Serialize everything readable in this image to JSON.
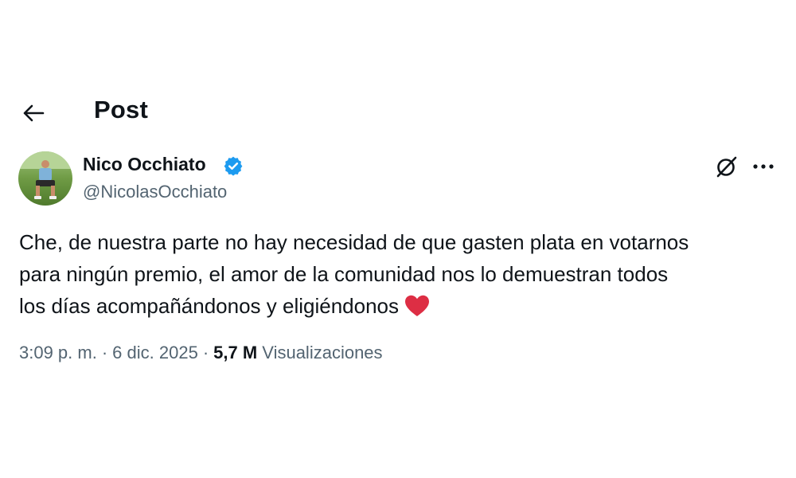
{
  "header": {
    "back_icon": "arrow-left-icon",
    "title": "Post"
  },
  "author": {
    "name": "Nico Occhiato",
    "handle": "@NicolasOcchiato",
    "verified": true,
    "verified_color": "#1d9bf0"
  },
  "actions": {
    "grok_icon": "grok-icon",
    "more_icon": "more-horizontal-icon"
  },
  "tweet": {
    "lines": [
      "Che, de nuestra parte no hay necesidad de que gasten plata en votarnos",
      "para ningún premio, el amor de la comunidad nos lo demuestran todos",
      "los días acompañándonos y eligiéndonos"
    ],
    "emoji": "heart-icon",
    "emoji_color": "#e0245e"
  },
  "meta": {
    "time": "3:09 p. m.",
    "separator": "·",
    "date": "6 dic. 2025",
    "views_count": "5,7 M",
    "views_label": "Visualizaciones"
  }
}
